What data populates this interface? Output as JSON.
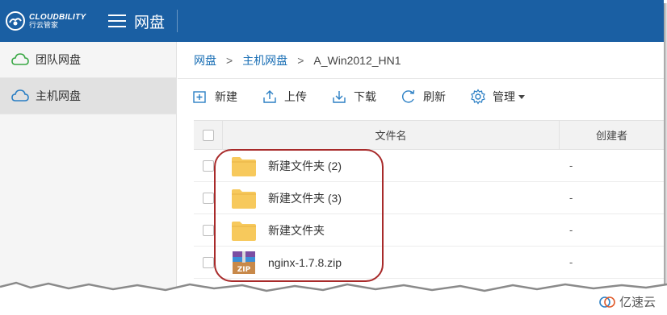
{
  "brand": {
    "name_en": "CLOUDBILITY",
    "name_cn": "行云管家"
  },
  "header": {
    "title": "网盘"
  },
  "sidebar": {
    "items": [
      {
        "label": "团队网盘",
        "active": false
      },
      {
        "label": "主机网盘",
        "active": true
      }
    ]
  },
  "breadcrumb": {
    "items": [
      "网盘",
      "主机网盘",
      "A_Win2012_HN1"
    ],
    "separator": ">"
  },
  "toolbar": {
    "new_label": "新建",
    "upload_label": "上传",
    "download_label": "下载",
    "refresh_label": "刷新",
    "manage_label": "管理"
  },
  "table": {
    "columns": [
      "文件名",
      "创建者"
    ],
    "rows": [
      {
        "name": "新建文件夹 (2)",
        "type": "folder",
        "creator": "-"
      },
      {
        "name": "新建文件夹 (3)",
        "type": "folder",
        "creator": "-"
      },
      {
        "name": "新建文件夹",
        "type": "folder",
        "creator": "-"
      },
      {
        "name": "nginx-1.7.8.zip",
        "type": "zip",
        "creator": "-"
      }
    ]
  },
  "icons": {
    "zip_label": "ZIP"
  },
  "watermark": {
    "text": "亿速云"
  },
  "colors": {
    "header_bg": "#1a5fa3",
    "link": "#1a6fb5",
    "folder": "#f7c95c",
    "highlight": "#a82a2a",
    "sidebar_icon": "#3aa845"
  }
}
